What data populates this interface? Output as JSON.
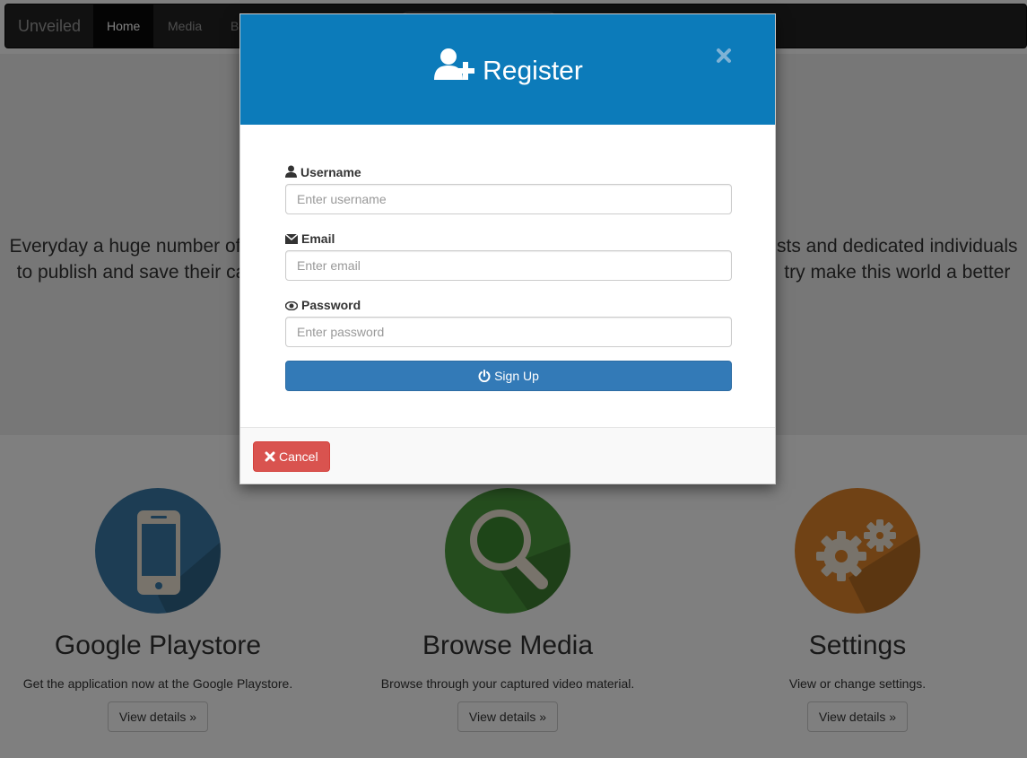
{
  "navbar": {
    "brand": "Unveiled",
    "items": [
      {
        "label": "Home",
        "active": true
      },
      {
        "label": "Media",
        "active": false
      },
      {
        "label": "Bl",
        "active": false
      }
    ]
  },
  "jumbotron": {
    "line1_left": "Everyday a huge number of u",
    "line1_right": "sts and dedicated individuals",
    "line2_left": "to publish and save their ca",
    "line2_right": "try make this world a better"
  },
  "features": [
    {
      "title": "Google Playstore",
      "text": "Get the application now at the Google Playstore.",
      "button": "View details »",
      "color": "#3a7ba8",
      "icon": "smartphone-icon"
    },
    {
      "title": "Browse Media",
      "text": "Browse through your captured video material.",
      "button": "View details »",
      "color": "#4a9a3c",
      "icon": "magnifier-icon"
    },
    {
      "title": "Settings",
      "text": "View or change settings.",
      "button": "View details »",
      "color": "#e0852b",
      "icon": "gears-icon"
    }
  ],
  "modal": {
    "title": "Register",
    "header_color": "#0c7bba",
    "close_icon": "close-icon",
    "fields": [
      {
        "label": "Username",
        "placeholder": "Enter username",
        "icon": "user-icon"
      },
      {
        "label": "Email",
        "placeholder": "Enter email",
        "icon": "envelope-icon"
      },
      {
        "label": "Password",
        "placeholder": "Enter password",
        "icon": "eye-icon"
      }
    ],
    "submit_label": "Sign Up",
    "cancel_label": "Cancel",
    "cancel_color": "#d9534f",
    "submit_color": "#337ab7"
  }
}
